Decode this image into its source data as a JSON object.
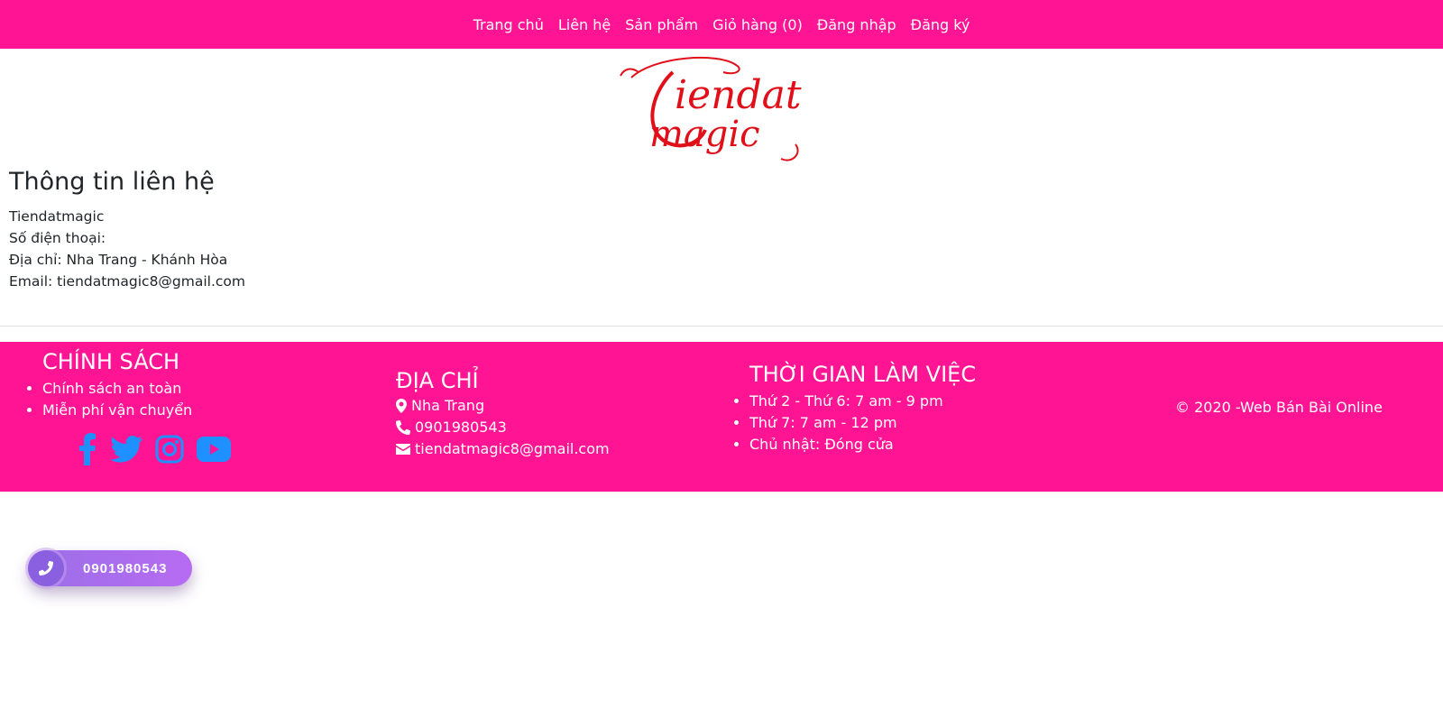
{
  "nav": {
    "items": [
      "Trang chủ",
      "Liên hệ",
      "Sản phẩm",
      "Giỏ hàng (0)",
      "Đăng nhập",
      "Đăng ký"
    ]
  },
  "logo": {
    "line1": "Tiendat",
    "line2": "magic",
    "color": "#e0101a"
  },
  "contact": {
    "title": "Thông tin liên hệ",
    "name": "Tiendatmagic",
    "phone_label": "Số điện thoại:",
    "address": "Địa chỉ: Nha Trang - Khánh Hòa",
    "email": "Email: tiendatmagic8@gmail.com"
  },
  "footer": {
    "policy": {
      "title": "CHÍNH SÁCH",
      "items": [
        "Chính sách an toàn",
        "Miễn phí vận chuyển"
      ]
    },
    "address": {
      "title": "ĐỊA CHỈ",
      "location": "Nha Trang",
      "phone": "0901980543",
      "email": "tiendatmagic8@gmail.com"
    },
    "hours": {
      "title": "THỜI GIAN LÀM VIỆC",
      "items": [
        "Thứ 2 - Thứ 6: 7 am - 9 pm",
        "Thứ 7: 7 am - 12 pm",
        "Chủ nhật: Đóng cửa"
      ]
    },
    "copyright": "© 2020 -Web Bán Bài Online",
    "social_icons": [
      "facebook-icon",
      "twitter-icon",
      "instagram-icon",
      "youtube-icon"
    ]
  },
  "call_button": {
    "number": "0901980543"
  },
  "colors": {
    "brand": "#ff1493",
    "social": "#1e90ff",
    "call": "#b06cf0"
  }
}
